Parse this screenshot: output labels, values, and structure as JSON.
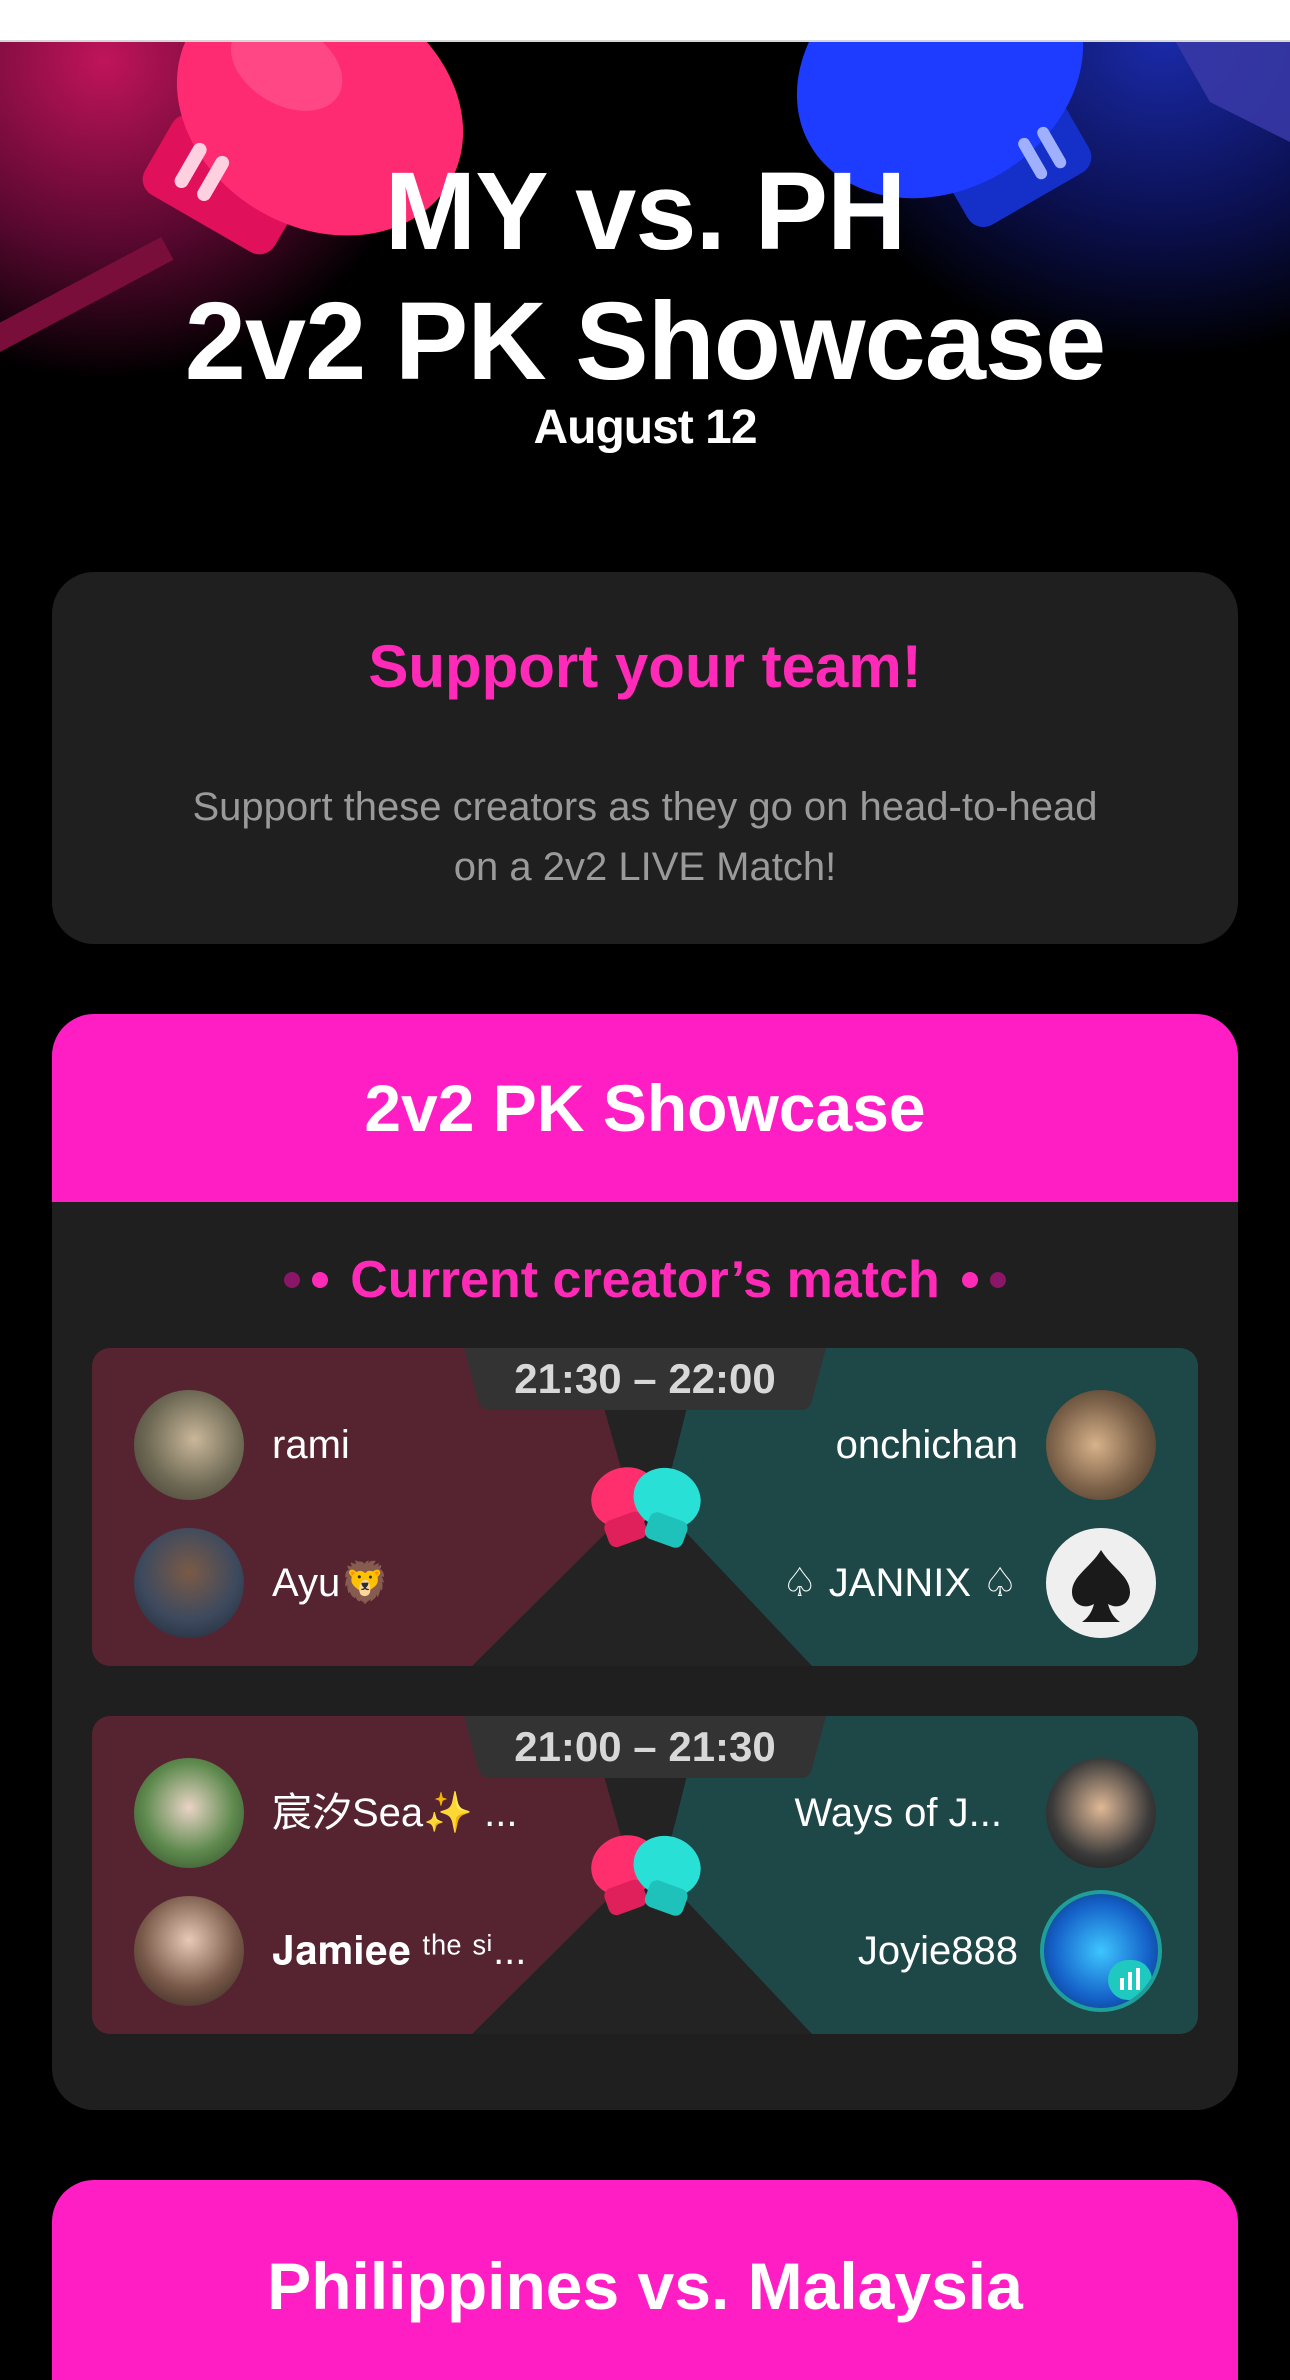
{
  "hero": {
    "title_line1": "MY vs. PH",
    "title_line2": "2v2 PK Showcase",
    "date": "August 12"
  },
  "support_card": {
    "title": "Support your team!",
    "text": "Support these creators as they go on head-to-head on a 2v2 LIVE Match!"
  },
  "showcase": {
    "header": "2v2 PK Showcase",
    "section_label": "Current creator’s match",
    "matches": [
      {
        "time": "21:30 – 22:00",
        "left": [
          {
            "name": "rami"
          },
          {
            "name": "Ayu🦁"
          }
        ],
        "right": [
          {
            "name": "onchichan"
          },
          {
            "name": "♤ JANNIX ♤"
          }
        ]
      },
      {
        "time": "21:00 – 21:30",
        "left": [
          {
            "name": "宸汐Sea✨ ..."
          },
          {
            "name": "𝐉𝐚𝐦𝐢𝐞𝐞 ᵗʰᵉ ˢⁱ..."
          }
        ],
        "right": [
          {
            "name": "Ways  of  J..."
          },
          {
            "name": "Joyie888"
          }
        ]
      }
    ]
  },
  "bottom_card": {
    "title": "Philippines vs. Malaysia"
  },
  "colors": {
    "accent_pink": "#ff1ec4",
    "team_left": "#5a2330",
    "team_right": "#1f4a4a",
    "glove_pink": "#ff2f6e",
    "glove_cyan": "#29e0d6"
  }
}
